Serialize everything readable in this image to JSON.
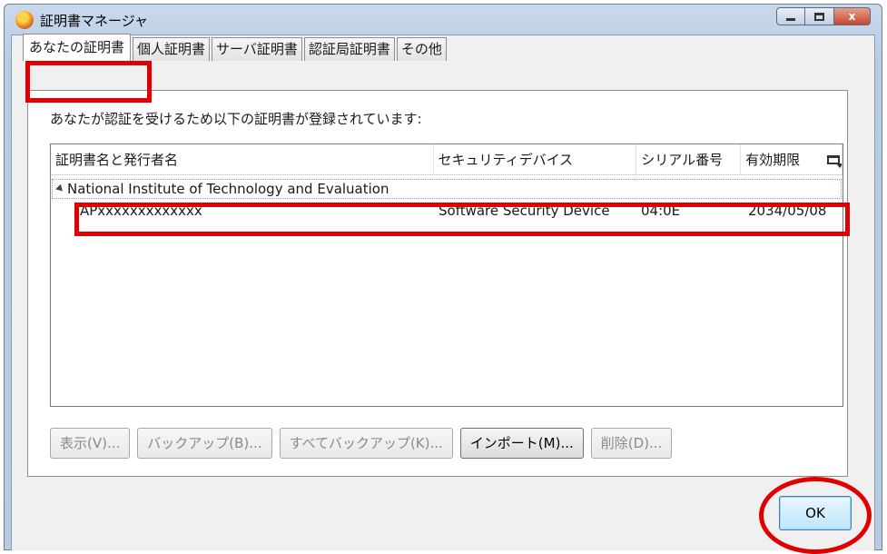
{
  "window": {
    "title": "証明書マネージャ",
    "controls": {
      "minimize": "minimize",
      "maximize": "maximize",
      "close": "x"
    }
  },
  "tabs": [
    {
      "label": "あなたの証明書",
      "active": true
    },
    {
      "label": "個人証明書",
      "active": false
    },
    {
      "label": "サーバ証明書",
      "active": false
    },
    {
      "label": "認証局証明書",
      "active": false
    },
    {
      "label": "その他",
      "active": false
    }
  ],
  "panel": {
    "intro": "あなたが認証を受けるため以下の証明書が登録されています:",
    "columns": {
      "name": "証明書名と発行者名",
      "device": "セキュリティデバイス",
      "serial": "シリアル番号",
      "expires": "有効期限"
    },
    "group": "National Institute of Technology and Evaluation",
    "certificate": {
      "name": "APxxxxxxxxxxxxx",
      "device": "Software Security Device",
      "serial": "04:0E",
      "expires": "2034/05/08"
    },
    "buttons": {
      "view": "表示(V)...",
      "backup": "バックアップ(B)...",
      "backup_all": "すべてバックアップ(K)...",
      "import": "インポート(M)...",
      "delete": "削除(D)..."
    }
  },
  "ok": "OK",
  "colors": {
    "annotation": "#e00000",
    "titlebar": "#b9cde6",
    "ok_button": "#bee6fd"
  }
}
